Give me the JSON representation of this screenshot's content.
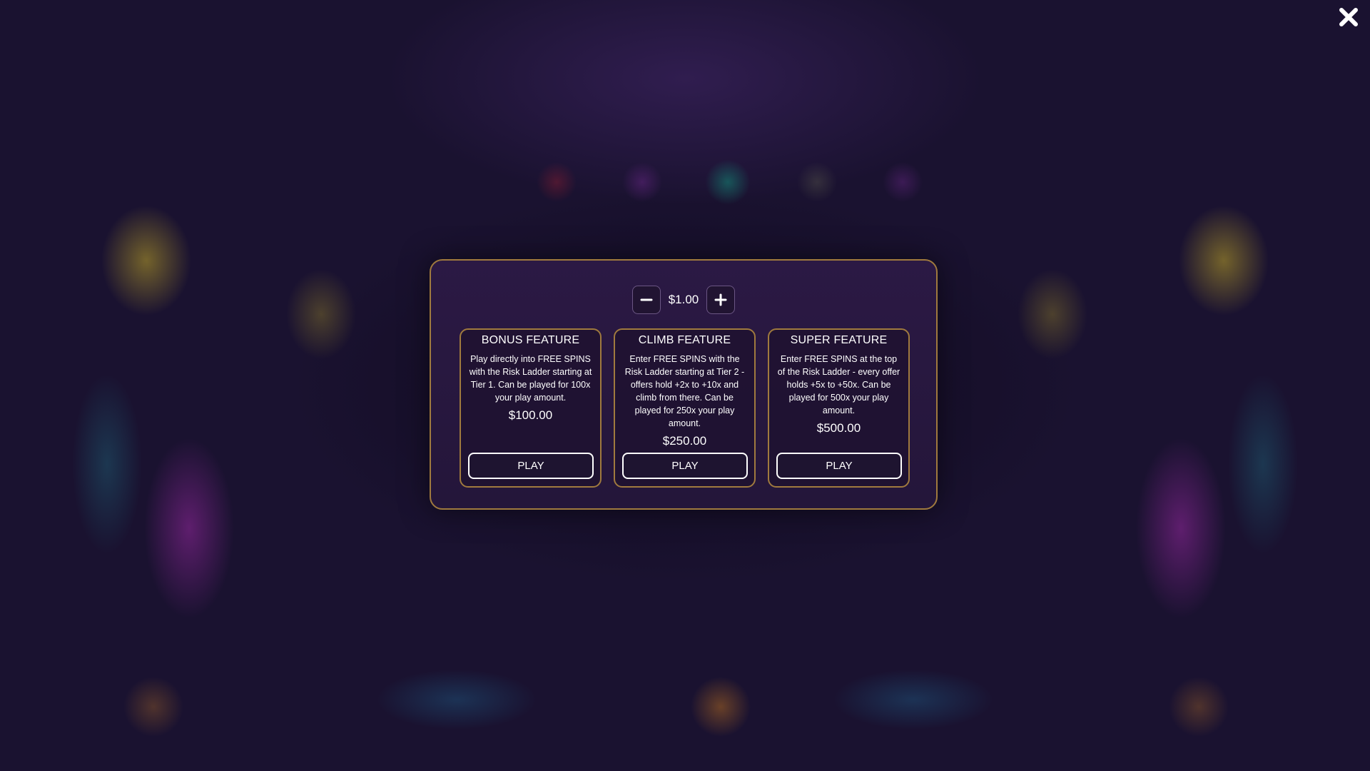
{
  "header": {
    "close_icon": "close-icon"
  },
  "stake": {
    "decrease_icon": "minus-icon",
    "increase_icon": "plus-icon",
    "value": "$1.00"
  },
  "features": [
    {
      "title": "BONUS FEATURE",
      "description": "Play directly into FREE SPINS with the Risk Ladder starting at Tier 1. Can be played for 100x your play amount.",
      "price": "$100.00",
      "play_label": "PLAY"
    },
    {
      "title": "CLIMB FEATURE",
      "description": "Enter FREE SPINS with the Risk Ladder starting at Tier 2 - offers hold +2x to +10x and climb from there. Can be played for 250x your play amount.",
      "price": "$250.00",
      "play_label": "PLAY"
    },
    {
      "title": "SUPER FEATURE",
      "description": "Enter FREE SPINS at the top of the Risk Ladder - every offer holds +5x to +50x. Can be played for 500x your play amount.",
      "price": "$500.00",
      "play_label": "PLAY"
    }
  ],
  "colors": {
    "modal_border": "#a07a3e",
    "modal_background": "#2b1944",
    "button_border": "#ffffff"
  }
}
